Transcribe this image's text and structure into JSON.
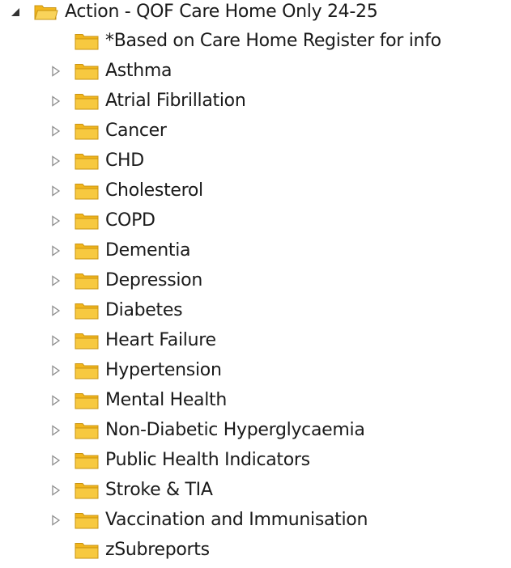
{
  "tree": {
    "root": {
      "label": "Action - QOF Care Home Only 24-25",
      "expanded": true,
      "icon": "folder-open-icon"
    },
    "children": [
      {
        "label": "*Based on Care Home Register for info",
        "expandable": false
      },
      {
        "label": "Asthma",
        "expandable": true
      },
      {
        "label": "Atrial Fibrillation",
        "expandable": true
      },
      {
        "label": "Cancer",
        "expandable": true
      },
      {
        "label": "CHD",
        "expandable": true
      },
      {
        "label": "Cholesterol",
        "expandable": true
      },
      {
        "label": "COPD",
        "expandable": true
      },
      {
        "label": "Dementia",
        "expandable": true
      },
      {
        "label": "Depression",
        "expandable": true
      },
      {
        "label": "Diabetes",
        "expandable": true
      },
      {
        "label": "Heart Failure",
        "expandable": true
      },
      {
        "label": "Hypertension",
        "expandable": true
      },
      {
        "label": "Mental Health",
        "expandable": true
      },
      {
        "label": "Non-Diabetic Hyperglycaemia",
        "expandable": true
      },
      {
        "label": "Public Health Indicators",
        "expandable": true
      },
      {
        "label": "Stroke & TIA",
        "expandable": true
      },
      {
        "label": "Vaccination and Immunisation",
        "expandable": true
      },
      {
        "label": "zSubreports",
        "expandable": false
      }
    ],
    "colors": {
      "folder_fill": "#f7c940",
      "folder_tab": "#f2b61c",
      "folder_edge": "#c89412",
      "arrow_expanded": "#333333",
      "arrow_collapsed": "#8c8c8c"
    }
  }
}
